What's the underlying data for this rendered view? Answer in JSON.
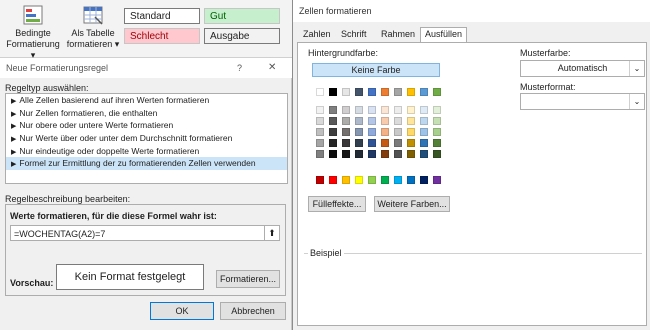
{
  "ribbon": {
    "cond_format_label_1": "Bedingte",
    "cond_format_label_2": "Formatierung",
    "as_table_label_1": "Als Tabelle",
    "as_table_label_2": "formatieren",
    "styles": [
      {
        "label": "Standard",
        "bg": "#ffffff"
      },
      {
        "label": "Gut",
        "bg": "#c6efce",
        "color": "#006100"
      },
      {
        "label": "Schlecht",
        "bg": "#ffc7ce",
        "color": "#9c0006"
      },
      {
        "label": "Ausgabe",
        "bg": "#f2f2f2"
      }
    ]
  },
  "new_rule_dialog": {
    "title": "Neue Formatierungsregel",
    "help": "?",
    "close": "✕",
    "rule_type_label": "Regeltyp auswählen:",
    "rule_types": [
      "Alle Zellen basierend auf ihren Werten formatieren",
      "Nur Zellen formatieren, die enthalten",
      "Nur obere oder untere Werte formatieren",
      "Nur Werte über oder unter dem Durchschnitt formatieren",
      "Nur eindeutige oder doppelte Werte formatieren",
      "Formel zur Ermittlung der zu formatierenden Zellen verwenden"
    ],
    "selected_rule_index": 5,
    "description_label": "Regelbeschreibung bearbeiten:",
    "formula_label": "Werte formatieren, für die diese Formel wahr ist:",
    "formula_value": "=WOCHENTAG(A2)=7",
    "preview_label": "Vorschau:",
    "preview_text": "Kein Format festgelegt",
    "format_button": "Formatieren...",
    "ok_button": "OK",
    "cancel_button": "Abbrechen"
  },
  "format_cells_dialog": {
    "title": "Zellen formatieren",
    "tabs": [
      "Zahlen",
      "Schrift",
      "Rahmen",
      "Ausfüllen"
    ],
    "active_tab": "Ausfüllen",
    "background_color_label": "Hintergrundfarbe:",
    "no_color_button": "Keine Farbe",
    "pattern_color_label": "Musterfarbe:",
    "pattern_color_value": "Automatisch",
    "pattern_style_label": "Musterformat:",
    "pattern_style_value": "",
    "fill_effects_button": "Fülleffekte...",
    "more_colors_button": "Weitere Farben...",
    "sample_label": "Beispiel",
    "theme_colors": [
      [
        "#ffffff",
        "#000000",
        "#e7e6e6",
        "#44546a",
        "#4472c4",
        "#ed7d31",
        "#a5a5a5",
        "#ffc000",
        "#5b9bd5",
        "#70ad47"
      ],
      [
        "#f2f2f2",
        "#7f7f7f",
        "#d0cece",
        "#d6dce4",
        "#d9e2f3",
        "#fbe5d5",
        "#ededed",
        "#fff2cc",
        "#deebf6",
        "#e2efd9"
      ],
      [
        "#d8d8d8",
        "#595959",
        "#aeabab",
        "#adb9ca",
        "#b4c6e7",
        "#f7cbac",
        "#dbdbdb",
        "#fee599",
        "#bdd7ee",
        "#c5e0b3"
      ],
      [
        "#bfbfbf",
        "#3f3f3f",
        "#757070",
        "#8496b0",
        "#8eaadb",
        "#f4b183",
        "#c9c9c9",
        "#ffd965",
        "#9dc3e6",
        "#a8d08d"
      ],
      [
        "#a5a5a5",
        "#262626",
        "#3a3838",
        "#323f4f",
        "#2f5496",
        "#c55a11",
        "#7b7b7b",
        "#bf9000",
        "#2e75b5",
        "#538135"
      ],
      [
        "#7f7f7f",
        "#0c0c0c",
        "#171616",
        "#222a35",
        "#1f3864",
        "#833c0b",
        "#525252",
        "#7f6000",
        "#1e4e79",
        "#375623"
      ]
    ],
    "standard_colors": [
      "#c00000",
      "#ff0000",
      "#ffc000",
      "#ffff00",
      "#92d050",
      "#00b050",
      "#00b0f0",
      "#0070c0",
      "#002060",
      "#7030a0"
    ]
  }
}
